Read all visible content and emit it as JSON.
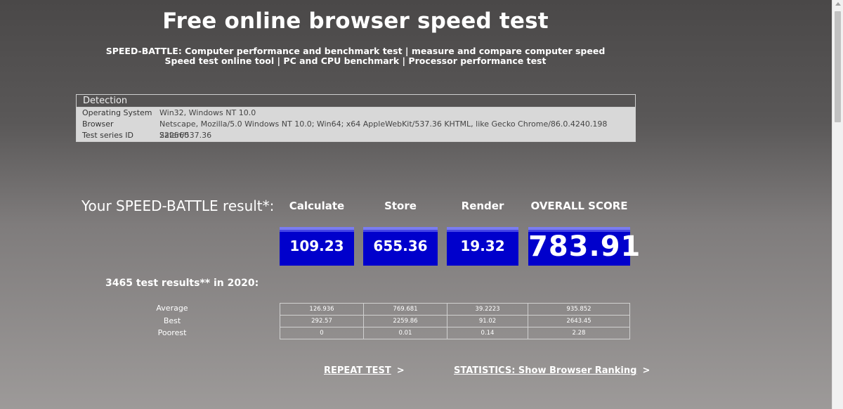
{
  "header": {
    "title": "Free online browser speed test",
    "subtitle_line1": "SPEED-BATTLE: Computer performance and benchmark test | measure and compare computer speed",
    "subtitle_line2": "Speed test online tool | PC and CPU benchmark | Processor performance test"
  },
  "detection": {
    "heading": "Detection",
    "rows": [
      {
        "label": "Operating System",
        "value": "Win32, Windows NT 10.0"
      },
      {
        "label": "Browser",
        "value": "Netscape, Mozilla/5.0 Windows NT 10.0; Win64; x64 AppleWebKit/537.36 KHTML, like Gecko Chrome/86.0.4240.198 Safari/537.36"
      },
      {
        "label": "Test series ID",
        "value": "222560"
      }
    ]
  },
  "result": {
    "label": "Your SPEED-BATTLE result*:",
    "columns": [
      "Calculate",
      "Store",
      "Render",
      "OVERALL SCORE"
    ],
    "values": [
      "109.23",
      "655.36",
      "19.32",
      "783.91"
    ],
    "accent_color": "#0000cc"
  },
  "stats": {
    "label": "3465 test results** in 2020:",
    "rows": [
      {
        "label": "Average",
        "values": [
          "126.936",
          "769.681",
          "39.2223",
          "935.852"
        ]
      },
      {
        "label": "Best",
        "values": [
          "292.57",
          "2259.86",
          "91.02",
          "2643.45"
        ]
      },
      {
        "label": "Poorest",
        "values": [
          "0",
          "0.01",
          "0.14",
          "2.28"
        ]
      }
    ]
  },
  "links": {
    "repeat": "REPEAT TEST",
    "statistics": "STATISTICS: Show Browser Ranking",
    "arrow": ">"
  }
}
